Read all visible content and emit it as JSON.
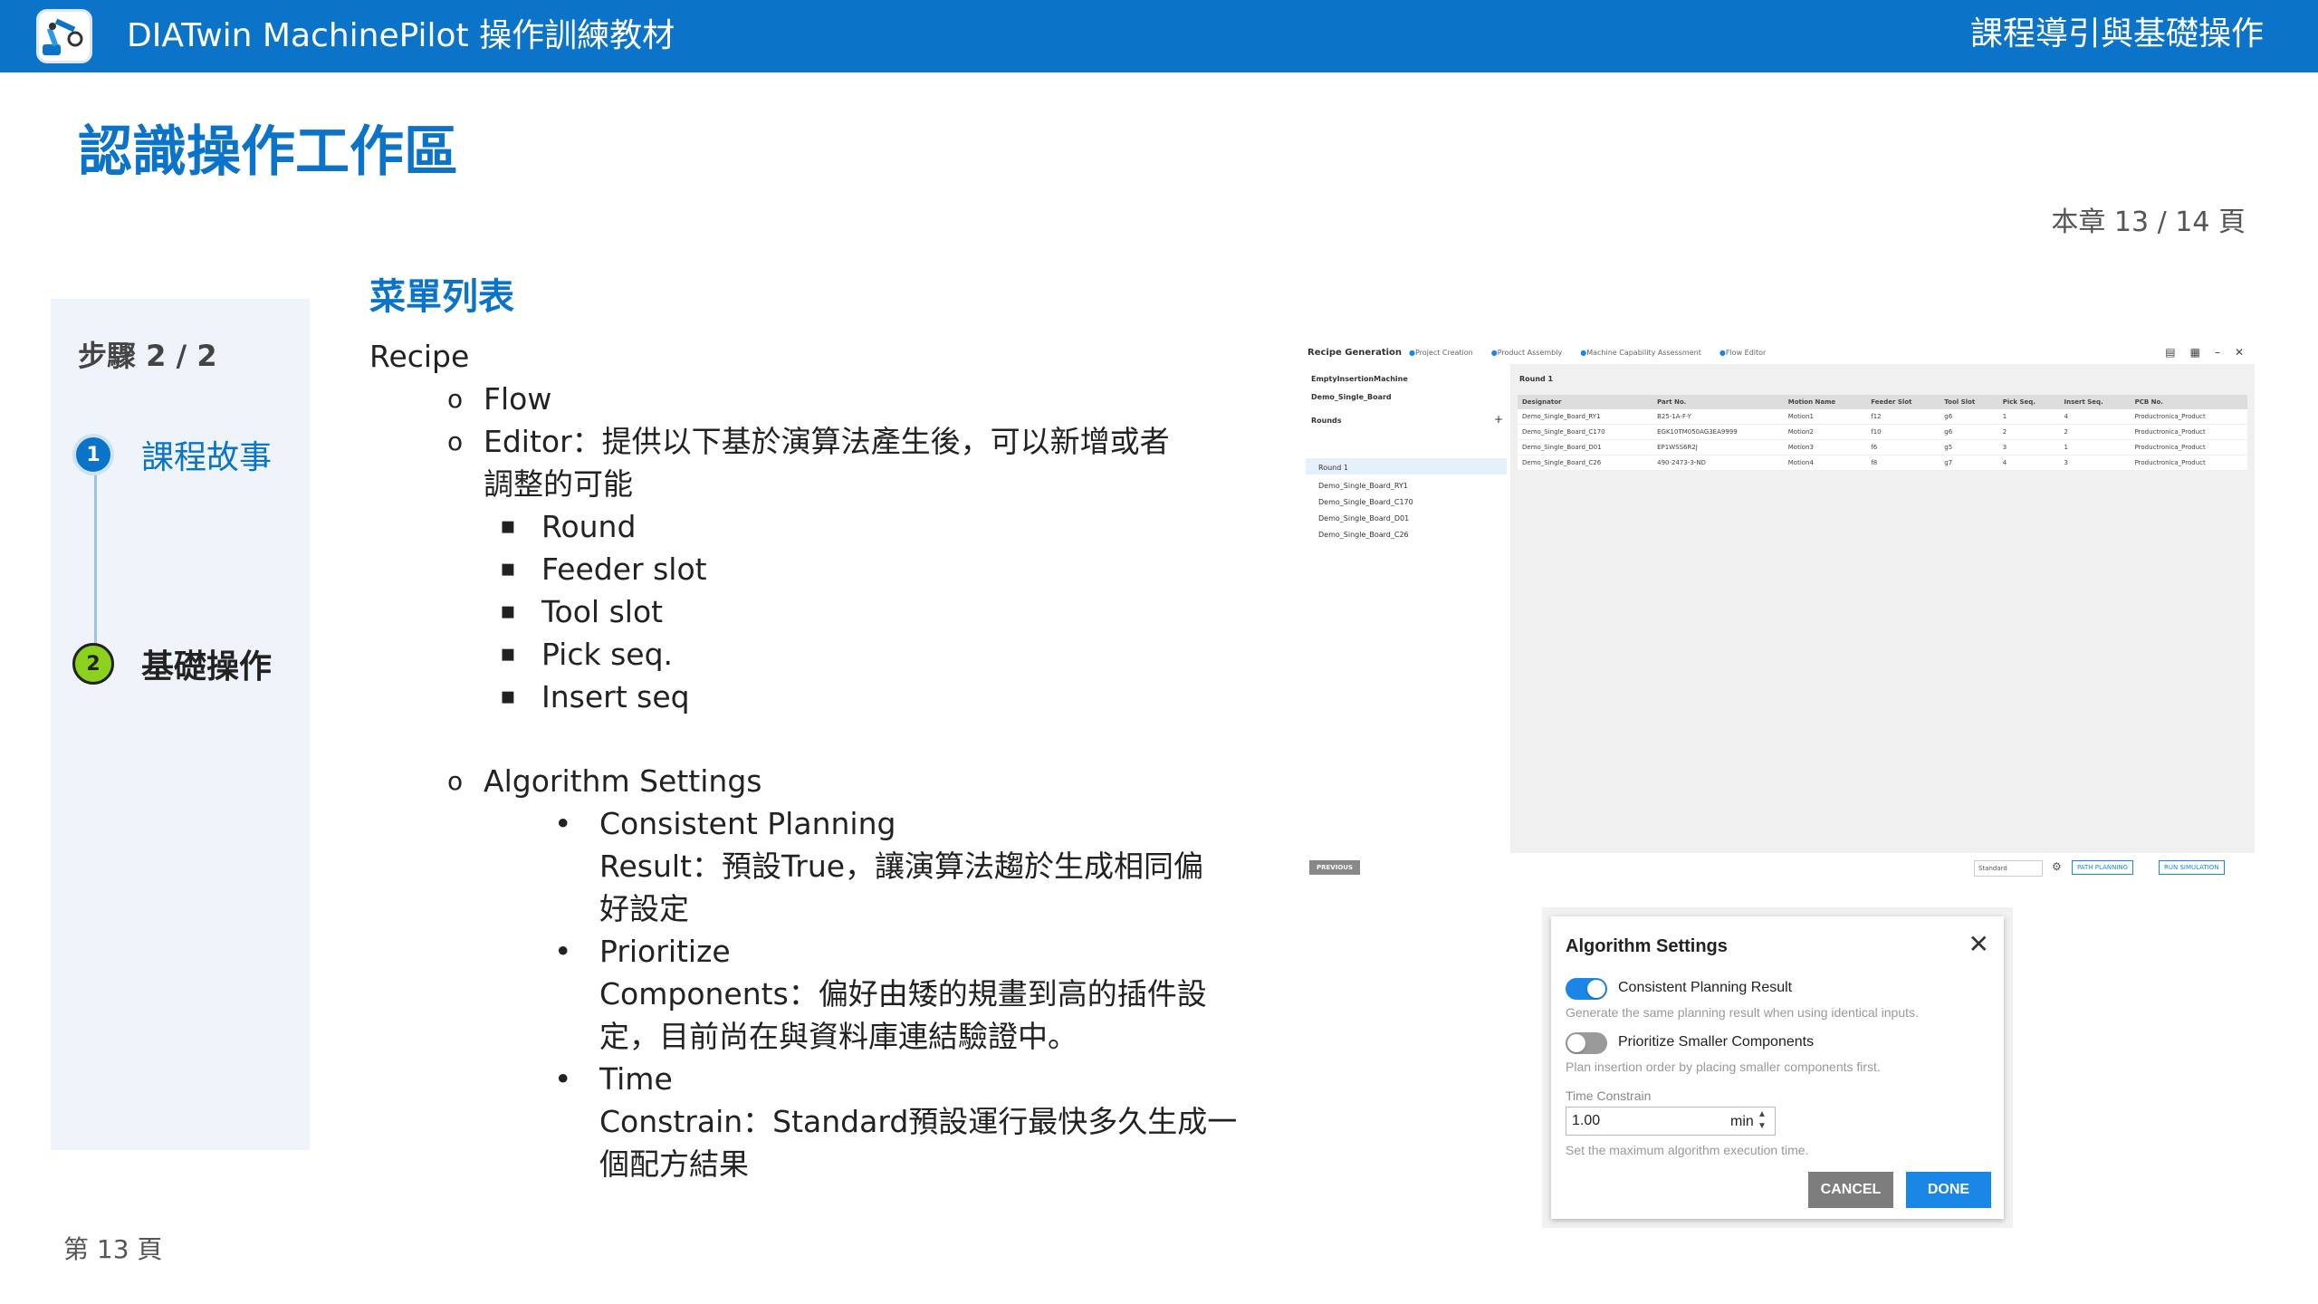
{
  "header": {
    "title": "DIATwin MachinePilot 操作訓練教材",
    "section": "課程導引與基礎操作",
    "logo_icon": "robot-arm-icon"
  },
  "page": {
    "title": "認識操作工作區",
    "chapter_progress": "本章 13 / 14 頁",
    "footer": "第 13 頁"
  },
  "steps": {
    "count": "步驟 2 / 2",
    "items": [
      {
        "num": "1",
        "label": "課程故事"
      },
      {
        "num": "2",
        "label": "基礎操作"
      }
    ]
  },
  "content": {
    "section_title": "菜單列表",
    "recipe": "Recipe",
    "flow": "Flow",
    "flow_desc_1": "Editor：提供以下基於演算法產生後，可以新增或者",
    "flow_desc_2": "調整的可能",
    "flow_items": [
      "Round",
      "Feeder slot",
      "Tool slot",
      "Pick seq.",
      "Insert seq"
    ],
    "algo": "Algorithm Settings",
    "algo_items": [
      {
        "l1": "Consistent Planning",
        "l2": "Result：預設True，讓演算法趨於生成相同偏",
        "l3": "好設定"
      },
      {
        "l1": "Prioritize",
        "l2": "Components：偏好由矮的規畫到高的插件設",
        "l3": "定，目前尚在與資料庫連結驗證中。"
      },
      {
        "l1": "Time",
        "l2": "Constrain：Standard預設運行最快多久生成一",
        "l3": "個配方結果"
      }
    ]
  },
  "screenshot": {
    "app_title": "Recipe Generation",
    "crumbs": [
      "Project Creation",
      "Product Assembly",
      "Machine Capability Assessment",
      "Flow Editor"
    ],
    "machine": "EmptyInsertionMachine",
    "board": "Demo_Single_Board",
    "rounds_label": "Rounds",
    "rounds": [
      "Round 1",
      "Demo_Single_Board_RY1",
      "Demo_Single_Board_C170",
      "Demo_Single_Board_D01",
      "Demo_Single_Board_C26"
    ],
    "grid_title": "Round 1",
    "columns": [
      "Designator",
      "Part No.",
      "Motion Name",
      "Feeder Slot",
      "Tool Slot",
      "Pick Seq.",
      "Insert Seq.",
      "PCB No."
    ],
    "rows": [
      [
        "Demo_Single_Board_RY1",
        "B25-1A-F-Y",
        "Motion1",
        "f12",
        "g6",
        "1",
        "4",
        "Productronica_Product"
      ],
      [
        "Demo_Single_Board_C170",
        "EGK10TM050AG3EA9999",
        "Motion2",
        "f10",
        "g6",
        "2",
        "2",
        "Productronica_Product"
      ],
      [
        "Demo_Single_Board_D01",
        "EP1WSS6R2J",
        "Motion3",
        "f6",
        "g5",
        "3",
        "1",
        "Productronica_Product"
      ],
      [
        "Demo_Single_Board_C26",
        "490-2473-3-ND",
        "Motion4",
        "f8",
        "g7",
        "4",
        "3",
        "Productronica_Product"
      ]
    ],
    "previous": "PREVIOUS",
    "mode": "Standard",
    "path_planning": "PATH PLANNING",
    "run_simulation": "RUN SIMULATION"
  },
  "dialog": {
    "title": "Algorithm Settings",
    "opt1_label": "Consistent Planning Result",
    "opt1_hint": "Generate the same planning result when using identical inputs.",
    "opt1_on": true,
    "opt2_label": "Prioritize Smaller Components",
    "opt2_hint": "Plan insertion order by placing smaller components first.",
    "opt2_on": false,
    "time_label": "Time Constrain",
    "time_value": "1.00",
    "time_unit": "min",
    "time_hint": "Set the maximum algorithm execution time.",
    "cancel": "CANCEL",
    "done": "DONE"
  },
  "colors": {
    "brand": "#0b74c9",
    "accent": "#1a86e6",
    "step2": "#8bd11e"
  }
}
